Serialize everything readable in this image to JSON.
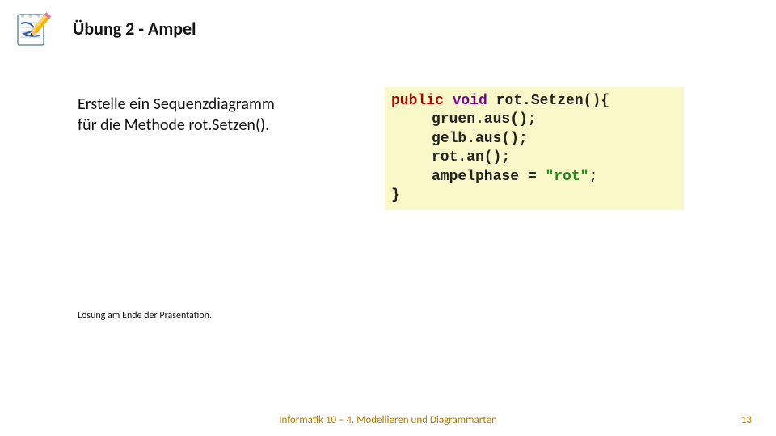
{
  "title": "Übung 2 - Ampel",
  "body": {
    "prompt_line1": "Erstelle ein Sequenzdiagramm",
    "prompt_line2": "für die Methode rot.Setzen()."
  },
  "code": {
    "kw_public": "public",
    "kw_void": "void",
    "method_decl": " rot.Setzen(){",
    "line2": "gruen.aus();",
    "line3": "gelb.aus();",
    "line4": "rot.an();",
    "line5_pre": "ampelphase = ",
    "line5_str": "\"rot\"",
    "line5_post": ";",
    "line6": "}"
  },
  "solution_note": "Lösung am Ende der Präsentation.",
  "footer": {
    "center": "Informatik 10 – 4. Modellieren und Diagrammarten",
    "page": "13"
  }
}
